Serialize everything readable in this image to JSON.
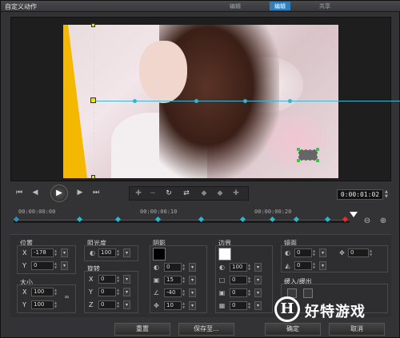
{
  "window": {
    "title": "自定义动作",
    "tabs": [
      "编辑",
      "编辑",
      "共享"
    ]
  },
  "transport": {
    "timecode": "0:00:01:02"
  },
  "ruler": {
    "labels": [
      "00:00:00:00",
      "00:00:00:10",
      "00:00:00:20"
    ]
  },
  "position": {
    "label": "位置",
    "x_label": "X",
    "x_value": "-178",
    "y_label": "Y",
    "y_value": "0"
  },
  "size": {
    "label": "大小",
    "x_label": "X",
    "x_value": "100",
    "y_label": "Y",
    "y_value": "100"
  },
  "opacity": {
    "label": "阻光度",
    "value": "100"
  },
  "rotation": {
    "label": "旋转",
    "x_label": "X",
    "x_value": "0",
    "y_label": "Y",
    "y_value": "0",
    "z_label": "Z",
    "z_value": "0"
  },
  "shadow": {
    "label": "阴影",
    "color": "#000000",
    "v1": "0",
    "v2": "15",
    "v3": "-40",
    "v4": "10"
  },
  "border": {
    "label": "边界",
    "color": "#ffffff",
    "v1": "100",
    "v2": "0",
    "v3": "0",
    "v4": "0"
  },
  "mirror": {
    "label": "镜面",
    "v1": "0",
    "v2": "0",
    "v3": "0"
  },
  "fade": {
    "label": "缓入/缓出"
  },
  "footer": {
    "reset": "重置",
    "save_to": "保存至...",
    "ok": "确定",
    "cancel": "取消"
  },
  "watermark": {
    "glyph": "H",
    "text": "好特游戏"
  }
}
